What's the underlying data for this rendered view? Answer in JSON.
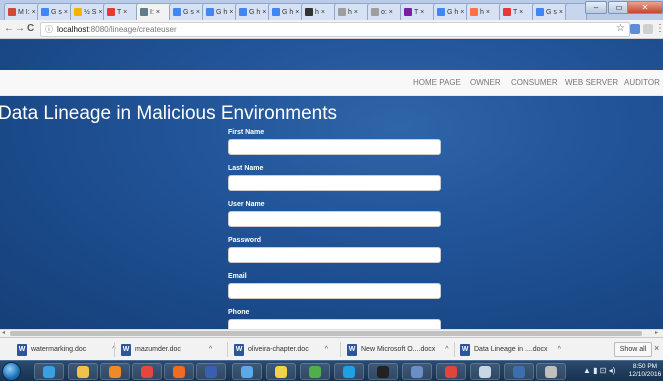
{
  "browser": {
    "tabs": [
      {
        "label": "M I: ×",
        "color": "#d14836"
      },
      {
        "label": "G s ×",
        "color": "#4285f4"
      },
      {
        "label": "½ S ×",
        "color": "#f4b400"
      },
      {
        "label": "T ×",
        "color": "#e53935"
      },
      {
        "label": "I: ×",
        "color": "#607d8b"
      },
      {
        "label": "G s ×",
        "color": "#4285f4"
      },
      {
        "label": "G h ×",
        "color": "#4285f4"
      },
      {
        "label": "G h ×",
        "color": "#4285f4"
      },
      {
        "label": "G h ×",
        "color": "#4285f4"
      },
      {
        "label": "h ×",
        "color": "#333333"
      },
      {
        "label": "h ×",
        "color": "#9e9e9e"
      },
      {
        "label": "o: ×",
        "color": "#9e9e9e"
      },
      {
        "label": "T ×",
        "color": "#7b1fa2"
      },
      {
        "label": "G h ×",
        "color": "#4285f4"
      },
      {
        "label": "h ×",
        "color": "#ff7043"
      },
      {
        "label": "T ×",
        "color": "#e53935"
      },
      {
        "label": "G s ×",
        "color": "#4285f4"
      }
    ],
    "window_controls": {
      "minimize": "–",
      "maximize": "▭",
      "close": "✕"
    },
    "nav": {
      "back": "←",
      "forward": "→",
      "reload": "C"
    },
    "address": {
      "info_icon": "ⓘ",
      "host": "localhost",
      "path": ":8080/lineage/createuser"
    },
    "star_icon": "☆",
    "menu_icon": "⋮"
  },
  "page": {
    "nav_links": [
      "HOME PAGE",
      "OWNER",
      "CONSUMER",
      "WEB SERVER",
      "AUDITOR"
    ],
    "title": "Data Lineage in Malicious Environments",
    "fields": [
      {
        "label": "First Name",
        "value": ""
      },
      {
        "label": "Last Name",
        "value": ""
      },
      {
        "label": "User Name",
        "value": ""
      },
      {
        "label": "Password",
        "value": ""
      },
      {
        "label": "Email",
        "value": ""
      },
      {
        "label": "Phone",
        "value": ""
      }
    ]
  },
  "downloads": {
    "items": [
      {
        "name": "watermarking.doc"
      },
      {
        "name": "mazumder.doc"
      },
      {
        "name": "oliveira-chapter.doc"
      },
      {
        "name": "New Microsoft O....docx"
      },
      {
        "name": "Data Lineage in ....docx"
      }
    ],
    "caret": "^",
    "show_all": "Show all",
    "close": "×"
  },
  "taskbar": {
    "apps": [
      {
        "icon": "ie-icon",
        "color": "#3aa0e6"
      },
      {
        "icon": "folder-icon",
        "color": "#f0c24b"
      },
      {
        "icon": "media-player-icon",
        "color": "#f08a24"
      },
      {
        "icon": "chrome-icon",
        "color": "#e8453c"
      },
      {
        "icon": "firefox-icon",
        "color": "#f36b21"
      },
      {
        "icon": "vpn-icon",
        "color": "#3b5fb0"
      },
      {
        "icon": "paint-icon",
        "color": "#5fa8e8"
      },
      {
        "icon": "notes-icon",
        "color": "#f2d24b"
      },
      {
        "icon": "app-icon",
        "color": "#4fb04a"
      },
      {
        "icon": "skype-icon",
        "color": "#1ea0e3"
      },
      {
        "icon": "cmd-icon",
        "color": "#222222"
      },
      {
        "icon": "remote-icon",
        "color": "#6b8fc4"
      },
      {
        "icon": "star-app-icon",
        "color": "#e0443a"
      },
      {
        "icon": "snipping-icon",
        "color": "#c9d6e6"
      },
      {
        "icon": "calc-icon",
        "color": "#3d6fb0"
      },
      {
        "icon": "java-icon",
        "color": "#c0c0c0"
      }
    ],
    "tray": "▲ ▮ ⊡ ◂)",
    "time": "8:50 PM",
    "date": "12/10/2016"
  }
}
